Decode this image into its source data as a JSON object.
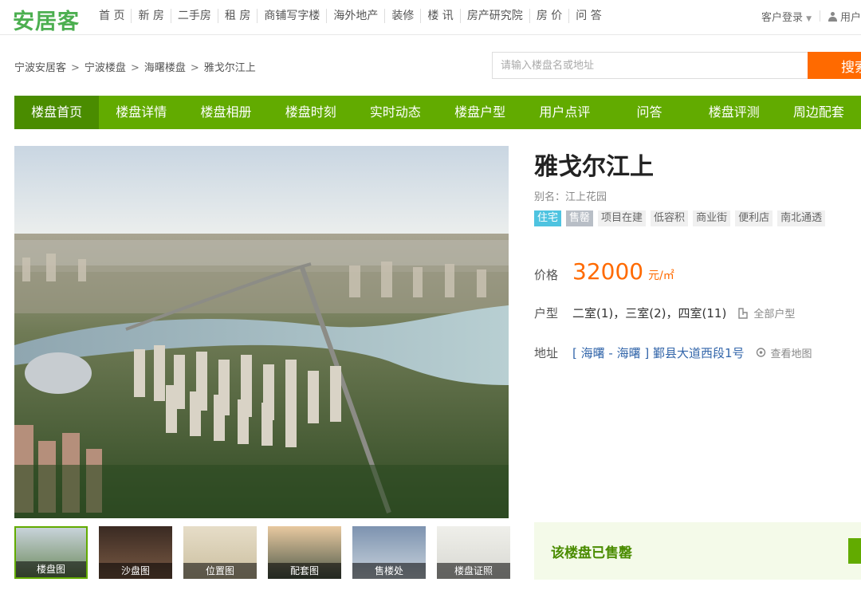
{
  "brand": {
    "logo": "安居客"
  },
  "top_nav": [
    "首 页",
    "新 房",
    "二手房",
    "租 房",
    "商铺写字楼",
    "海外地产",
    "装修",
    "楼 讯",
    "房产研究院",
    "房 价",
    "问 答"
  ],
  "top_right": {
    "login": "客户登录",
    "user": "用户"
  },
  "breadcrumb": [
    "宁波安居客",
    "宁波楼盘",
    "海曙楼盘",
    "雅戈尔江上"
  ],
  "search": {
    "placeholder": "请输入楼盘名或地址",
    "button": "搜索"
  },
  "tabs": [
    "楼盘首页",
    "楼盘详情",
    "楼盘相册",
    "楼盘时刻",
    "实时动态",
    "楼盘户型",
    "用户点评",
    "问答",
    "楼盘评测",
    "周边配套"
  ],
  "thumbs": [
    "楼盘图",
    "沙盘图",
    "位置图",
    "配套图",
    "售楼处",
    "楼盘证照"
  ],
  "property": {
    "name": "雅戈尔江上",
    "alias": "别名：江上花园",
    "tags": [
      "住宅",
      "售罄",
      "项目在建",
      "低容积",
      "商业街",
      "便利店",
      "南北通透"
    ],
    "price_label": "价格",
    "price": "32000",
    "price_unit": "元/㎡",
    "layout_label": "户型",
    "layouts": "二室(1)，三室(2)，四室(11)",
    "all_layouts": "全部户型",
    "address_label": "地址",
    "address": "[ 海曙 - 海曙 ] 鄞县大道西段1号",
    "view_map": "查看地图"
  },
  "sold_notice": "该楼盘已售罄",
  "colors": {
    "brand_green": "#62ab00",
    "accent_orange": "#ff6a00",
    "link_blue": "#3366aa"
  }
}
